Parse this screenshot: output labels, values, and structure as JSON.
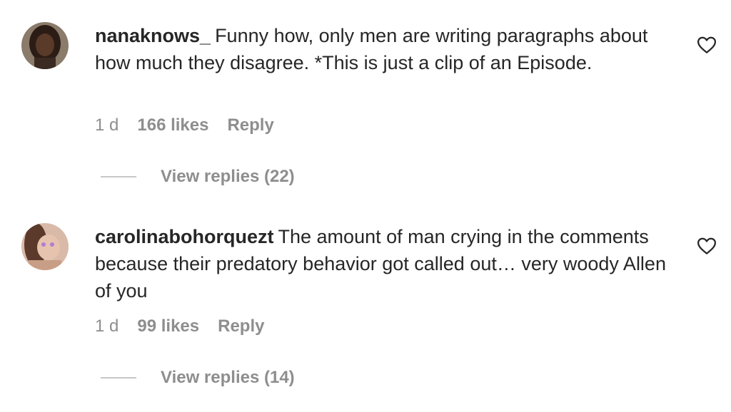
{
  "comments": [
    {
      "username": "nanaknows_",
      "text": "Funny how, only men are writing paragraphs about how much they disagree. *This is just a clip of an Episode.",
      "time": "1 d",
      "likes": "166 likes",
      "reply_label": "Reply",
      "view_replies": "View replies (22)",
      "icon": "heart-outline-icon"
    },
    {
      "username": "carolinabohorquezt",
      "text": "The amount of man crying in the comments because their predatory behavior got called out… very woody Allen of you",
      "time": "1 d",
      "likes": "99 likes",
      "reply_label": "Reply",
      "view_replies": "View replies (14)",
      "icon": "heart-outline-icon"
    }
  ],
  "colors": {
    "text": "#262626",
    "secondary": "#8e8e8e",
    "divider": "#c7c7c7"
  }
}
